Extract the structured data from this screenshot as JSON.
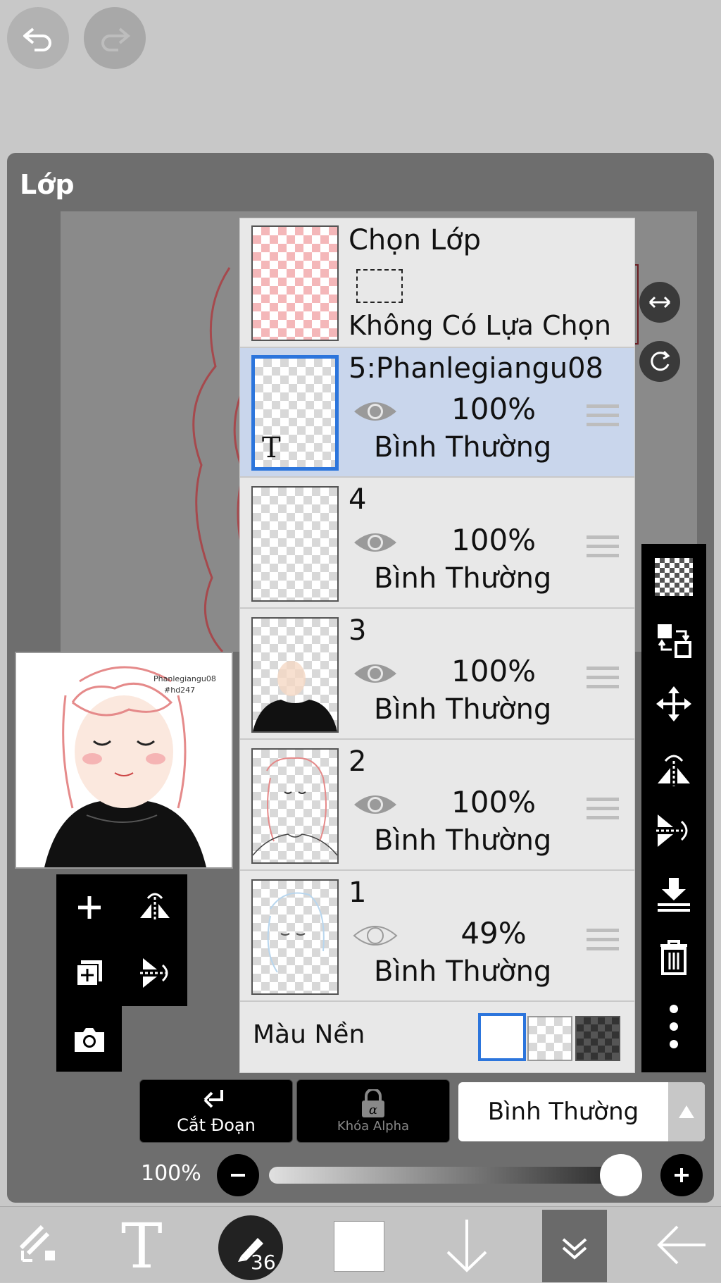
{
  "header": {
    "undo_icon": "undo-arrow-icon",
    "redo_icon": "redo-arrow-icon"
  },
  "panel": {
    "title": "Lớp"
  },
  "selection_layer": {
    "title": "Chọn Lớp",
    "subtitle": "Không Có Lựa Chọn"
  },
  "layers": [
    {
      "name": "5:Phanlegiangu08",
      "opacity": "100%",
      "blend": "Bình Thường",
      "selected": true,
      "type": "text",
      "text_icon": "T"
    },
    {
      "name": "4",
      "opacity": "100%",
      "blend": "Bình Thường",
      "selected": false
    },
    {
      "name": "3",
      "opacity": "100%",
      "blend": "Bình Thường",
      "selected": false
    },
    {
      "name": "2",
      "opacity": "100%",
      "blend": "Bình Thường",
      "selected": false
    },
    {
      "name": "1",
      "opacity": "49%",
      "blend": "Bình Thường",
      "selected": false,
      "visible_dim": true
    }
  ],
  "background_color": {
    "label": "Màu Nền",
    "options": [
      "white",
      "transparent",
      "dark-checker"
    ],
    "selected": "white"
  },
  "preview": {
    "watermark_line1": "Phanlegiangu08",
    "watermark_line2": "#hd247"
  },
  "actions": {
    "clip_label": "Cắt Đoạn",
    "alpha_lock_label": "Khóa Alpha",
    "blend_mode": "Bình Thường"
  },
  "opacity_slider": {
    "label": "100%",
    "value": 1.0
  },
  "toolbar": {
    "brush_size": "36"
  },
  "colors": {
    "accent": "#2c75dc",
    "selected_row": "#c9d6ec"
  }
}
